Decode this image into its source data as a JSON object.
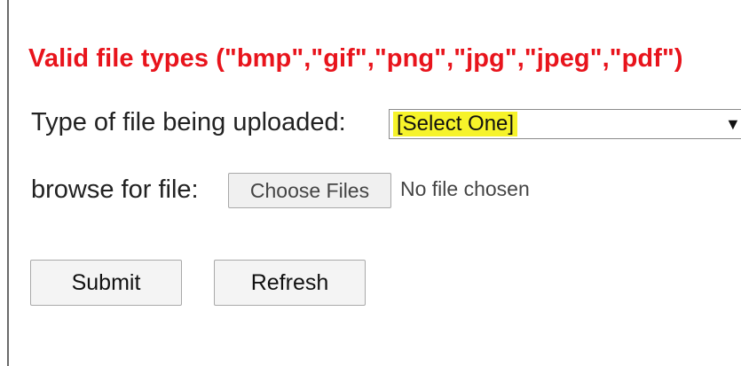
{
  "form": {
    "valid_types_notice": "Valid file types (\"bmp\",\"gif\",\"png\",\"jpg\",\"jpeg\",\"pdf\")",
    "type_label": "Type of file being uploaded:",
    "type_select": {
      "selected": "[Select One]",
      "arrow_glyph": "▼"
    },
    "browse_label": "browse for file:",
    "file_input": {
      "button_label": "Choose Files",
      "status": "No file chosen"
    },
    "submit_label": "Submit",
    "refresh_label": "Refresh"
  },
  "colors": {
    "notice_red": "#e8141c",
    "select_highlight": "#f6f32a",
    "text": "#222222",
    "button_bg": "#f4f4f4",
    "border": "#a9a9a9"
  }
}
